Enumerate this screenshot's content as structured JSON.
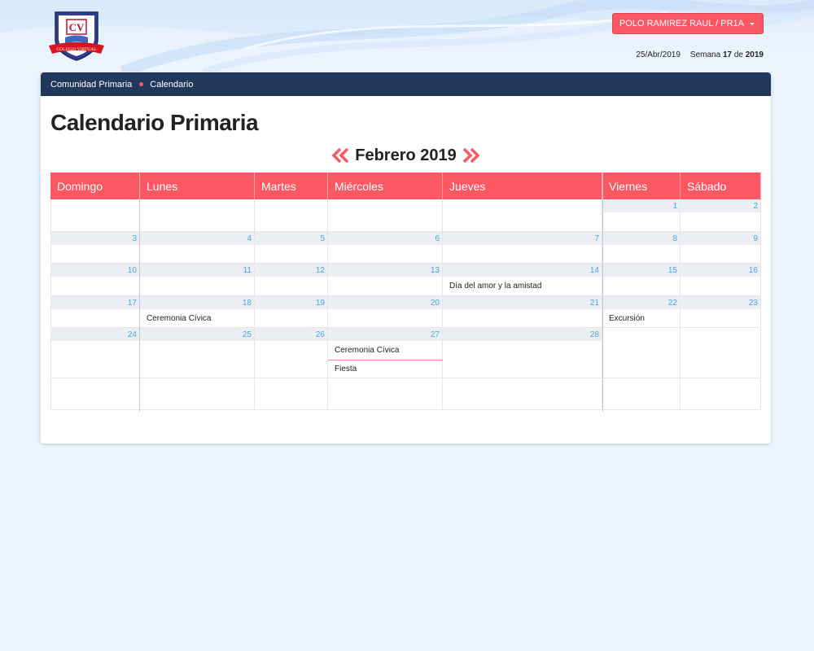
{
  "header": {
    "logo_letters": "CV",
    "logo_ribbon": "COLEGIO VIRTUAL",
    "user_button": "POLO RAMIREZ RAUL / PR1A",
    "date": "25/Abr/2019",
    "week_label": "Semana",
    "week_number": "17",
    "week_of": "de",
    "year": "2019",
    "accent_color": "#fb5863",
    "nav_color": "#21385c"
  },
  "breadcrumb": {
    "items": [
      "Comunidad Primaria",
      "Calendario"
    ]
  },
  "page_title": "Calendario Primaria",
  "calendar": {
    "month_title": "Febrero 2019",
    "prev_icon": "double-chevron-left-icon",
    "next_icon": "double-chevron-right-icon",
    "weekdays": [
      "Domingo",
      "Lunes",
      "Martes",
      "Miércoles",
      "Jueves",
      "Viernes",
      "Sábado"
    ],
    "weeks": [
      [
        "",
        "",
        "",
        "",
        "",
        "1",
        "2"
      ],
      [
        "3",
        "4",
        "5",
        "6",
        "7",
        "8",
        "9"
      ],
      [
        "10",
        "11",
        "12",
        "13",
        "14",
        "15",
        "16"
      ],
      [
        "17",
        "18",
        "19",
        "20",
        "21",
        "22",
        "23"
      ],
      [
        "24",
        "25",
        "26",
        "27",
        "28",
        "",
        ""
      ],
      [
        "",
        "",
        "",
        "",
        "",
        "",
        ""
      ]
    ],
    "events": [
      {
        "date": "14",
        "title": "Día del amor y la amistad"
      },
      {
        "date": "18",
        "title": "Ceremonia Cívica"
      },
      {
        "date": "22",
        "title": "Excursión"
      },
      {
        "date": "27",
        "title": "Ceremonia Cívica"
      },
      {
        "date": "27",
        "title": "Fiesta"
      }
    ]
  }
}
